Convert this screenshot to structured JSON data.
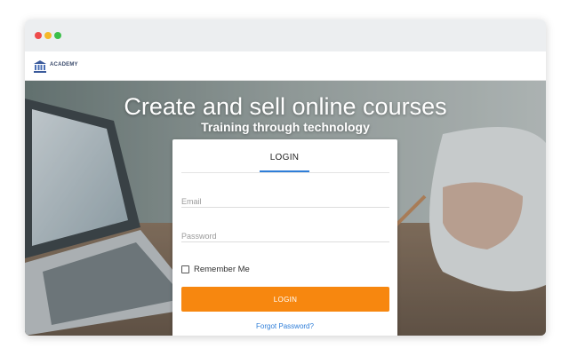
{
  "window": {
    "controls": [
      "close",
      "minimize",
      "maximize"
    ]
  },
  "navbar": {
    "brand": "ACADEMY",
    "logo_icon": "academy-building-icon"
  },
  "hero": {
    "headline": "Create and sell online courses",
    "subheadline": "Training through technology"
  },
  "login_card": {
    "tab_label": "LOGIN",
    "email_placeholder": "Email",
    "email_value": "",
    "password_placeholder": "Password",
    "password_value": "",
    "remember_label": "Remember Me",
    "remember_checked": false,
    "login_button": "LOGIN",
    "forgot_link": "Forgot Password?"
  },
  "colors": {
    "accent_orange": "#f7870f",
    "link_blue": "#2f7ed8",
    "titlebar": "#eceef0"
  }
}
